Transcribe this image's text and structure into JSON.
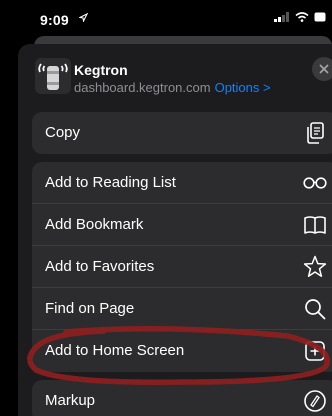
{
  "status": {
    "time": "9:09"
  },
  "site": {
    "name": "Kegtron",
    "url": "dashboard.kegtron.com",
    "options_label": "Options >"
  },
  "actions": {
    "copy": "Copy",
    "reading_list": "Add to Reading List",
    "bookmark": "Add Bookmark",
    "favorites": "Add to Favorites",
    "find": "Find on Page",
    "home_screen": "Add to Home Screen",
    "markup": "Markup"
  },
  "colors": {
    "sheet": "#1c1c1e",
    "row": "#2c2c2e",
    "link": "#0a84ff",
    "annotation": "#8e1f1f"
  },
  "icons": [
    "location-arrow-icon",
    "signal-icon",
    "wifi-icon",
    "battery-icon",
    "close-icon",
    "copy-icon",
    "glasses-icon",
    "book-icon",
    "star-icon",
    "magnifier-icon",
    "plus-square-icon",
    "markup-icon"
  ]
}
